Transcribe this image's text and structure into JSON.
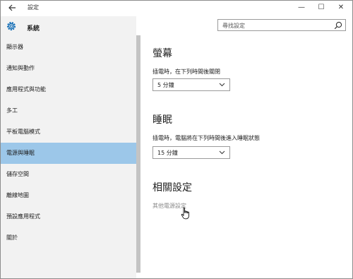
{
  "window": {
    "title": "設定",
    "back_icon": "back-arrow-icon",
    "minimize": "—",
    "maximize": "☐",
    "close": "✕"
  },
  "sidebar": {
    "section_title": "系統",
    "section_icon": "gear-icon",
    "items": [
      {
        "label": "顯示器"
      },
      {
        "label": "通知與動作"
      },
      {
        "label": "應用程式與功能"
      },
      {
        "label": "多工"
      },
      {
        "label": "平板電腦模式"
      },
      {
        "label": "電源與睡眠",
        "active": true
      },
      {
        "label": "儲存空間"
      },
      {
        "label": "離線地圖"
      },
      {
        "label": "預設應用程式"
      },
      {
        "label": "關於"
      }
    ]
  },
  "search": {
    "placeholder": "尋找設定"
  },
  "main": {
    "screen": {
      "heading": "螢幕",
      "label": "插電時，在下列時間後關閉",
      "value": "5 分鐘"
    },
    "sleep": {
      "heading": "睡眠",
      "label": "插電時，電腦將在下列時間後進入睡眠狀態",
      "value": "15 分鐘"
    },
    "related": {
      "heading": "相關設定",
      "link": "其他電源設定"
    }
  },
  "colors": {
    "active_item": "#9cc7e9",
    "sidebar_bg": "#f2f2f2",
    "accent": "#0063b1"
  }
}
